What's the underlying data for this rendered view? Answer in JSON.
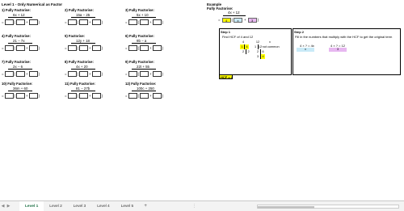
{
  "title": "Level 1 - Only Numerical as Factor",
  "questions": [
    {
      "num": "1)",
      "label": "Fully Factorise:",
      "expr": "6x + 12"
    },
    {
      "num": "2)",
      "label": "Fully Factorise:",
      "expr": "15a − 25"
    },
    {
      "num": "3)",
      "label": "Fully Factorise:",
      "expr": "5x + 10"
    },
    {
      "num": "4)",
      "label": "Fully Factorise:",
      "expr": "21 − 7x"
    },
    {
      "num": "5)",
      "label": "Factorise:",
      "expr": "12y + 18"
    },
    {
      "num": "6)",
      "label": "Fully Factorise:",
      "expr": "9b − a"
    },
    {
      "num": "7)",
      "label": "Fully Factorise:",
      "expr": "2x − 6"
    },
    {
      "num": "8)",
      "label": "Fully Factorise:",
      "expr": "4x + 20"
    },
    {
      "num": "9)",
      "label": "Fully Factorise:",
      "expr": "22t + 55"
    },
    {
      "num": "10)",
      "label": "Fully Factorise:",
      "expr": "36m + 60"
    },
    {
      "num": "11)",
      "label": "Fully Factorise:",
      "expr": "81 − 27b"
    },
    {
      "num": "12)",
      "label": "Fully Factorise:",
      "expr": "100c + 250"
    }
  ],
  "answer_template": {
    "eq": "=",
    "open": "(",
    "close": ")",
    "plus": "+"
  },
  "example": {
    "heading": "Example",
    "label": "Fully Factorise:",
    "expr": "4x + 12",
    "eq": "=",
    "factor": "4",
    "open": "(",
    "term1": "x",
    "plus": "+",
    "term2": "3",
    "close": ")"
  },
  "step1": {
    "title": "Step 1",
    "subtitle": "Find HCF of 4 and 12",
    "headers": [
      "4",
      "12",
      "x"
    ],
    "rows": [
      [
        "1",
        "4",
        "1",
        "12",
        "not common"
      ],
      [
        "2",
        "2",
        "2",
        "6",
        ""
      ],
      [
        "",
        "",
        "3",
        "4",
        ""
      ]
    ],
    "hcf": "HCF = 4"
  },
  "step2": {
    "title": "Step 2",
    "subtitle": "Fill in the numbers that multiply with the HCF to get the original term",
    "left_label": "4 × ? = 4x",
    "right_label": "4 × ? = 12",
    "left_value": "x",
    "right_value": "3"
  },
  "sheet_tabs": [
    "Level 1",
    "Level 2",
    "Level 3",
    "Level 4",
    "Level 5"
  ],
  "active_tab": "Level 1",
  "add_tab": "+",
  "dots": "⋮",
  "colors": {
    "yellow": "#ffff00",
    "blue": "#c9eaf7",
    "pink": "#e7b7f0",
    "tab_green": "#1e7145"
  }
}
